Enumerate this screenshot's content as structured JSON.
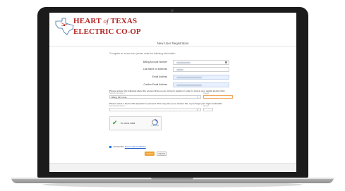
{
  "logo": {
    "line1_a": "HEART",
    "line1_b": "of",
    "line1_c": "TEXAS",
    "line2": "ELECTRIC CO-OP"
  },
  "page": {
    "title": "New User Registration",
    "intro": "To register as a new user, please enter the following information:"
  },
  "form": {
    "fields": [
      {
        "label": "Billing Account Number"
      },
      {
        "label": "Last Name or Business"
      },
      {
        "label": "Email Address"
      },
      {
        "label": "Confirm Email Address"
      }
    ],
    "security_q1": {
      "prompt": "Please answer the following about the account that you are trying to register in order to protect your capital identity theft.",
      "question_caption": "Security Question 1",
      "answer_caption": "Answer",
      "selected": "Billing ZIP Code"
    },
    "security_q2": {
      "prompt": "Please select a Secret Hint Question to proceed. This may ask you to answer this, if you forget your login credentials.",
      "question_caption": "Security Question 2",
      "answer_caption": "Answer",
      "selected": ""
    },
    "captcha": {
      "label": "I'm not a robot",
      "brand": "reCAPTCHA"
    },
    "terms": {
      "prefix": "I accept the",
      "link": "Terms and Conditions"
    },
    "submit_label": "Submit",
    "cancel_label": "Cancel"
  },
  "colors": {
    "brand_red": "#b22222",
    "accent_orange": "#f0a030",
    "link_blue": "#1a56c8"
  }
}
